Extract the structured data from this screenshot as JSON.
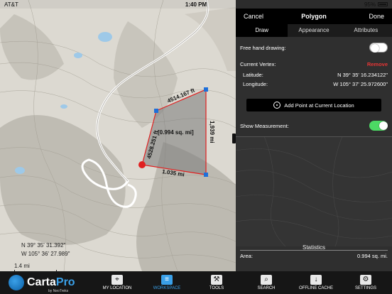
{
  "status_bar": {
    "carrier": "AT&T",
    "time": "1:40 PM",
    "battery": "95%"
  },
  "map": {
    "area_label": "[0.994 sq. mi]",
    "edges": {
      "top": "4514.167 ft",
      "right": "1,939 mi",
      "bottom": "1.035 mi",
      "left": "4528.251 ft"
    },
    "coord_lat": "N 39° 35' 31.392\"",
    "coord_lon": "W 105° 36' 27.989\"",
    "scale_label": "1.4 mi"
  },
  "panel": {
    "nav": {
      "cancel": "Cancel",
      "title": "Polygon",
      "done": "Done"
    },
    "tabs": [
      {
        "label": "Draw",
        "active": true
      },
      {
        "label": "Appearance",
        "active": false
      },
      {
        "label": "Attributes",
        "active": false
      }
    ],
    "freehand_label": "Free hand drawing:",
    "current_vertex_label": "Current Vertex:",
    "remove_label": "Remove",
    "latitude_label": "Latitude:",
    "latitude_value": "N 39° 35' 16.234122\"",
    "longitude_label": "Longitude:",
    "longitude_value": "W 105° 37' 25.972600\"",
    "add_point_label": "Add Point at Current Location",
    "show_measurement_label": "Show Measurement:",
    "statistics_label": "Statistics",
    "area_label": "Area:",
    "area_value": "0.994 sq. mi."
  },
  "toolbar": {
    "brand_name": "Carta",
    "brand_pro": "Pro",
    "brand_sub": "by NeoTreks",
    "items": [
      {
        "label": "MY LOCATION",
        "icon": "location-icon"
      },
      {
        "label": "WORKSPACE",
        "icon": "layers-icon",
        "active": true
      },
      {
        "label": "TOOLS",
        "icon": "tools-icon"
      },
      {
        "label": "SEARCH",
        "icon": "search-icon"
      },
      {
        "label": "OFFLINE CACHE",
        "icon": "download-icon"
      },
      {
        "label": "SETTINGS",
        "icon": "settings-icon"
      }
    ]
  },
  "colors": {
    "accent": "#3aa0e8",
    "toggle_on": "#4cd964",
    "remove": "#e53535",
    "polygon_edge": "#e02020",
    "vertex": "#1e6fd9"
  }
}
